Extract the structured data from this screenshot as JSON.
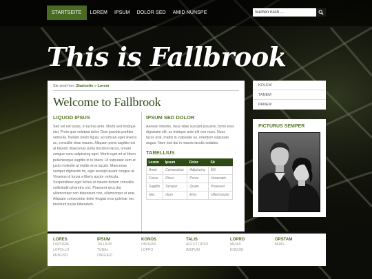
{
  "nav": {
    "items": [
      "STARTSEITE",
      "LOREM",
      "IPSUM",
      "DOLOR SED",
      "AMID NUNSPE"
    ],
    "active_index": 0
  },
  "search": {
    "placeholder": "Suchen nach ..."
  },
  "site": {
    "title": "This is Fallbrook"
  },
  "breadcrumb": {
    "prefix": "Sie sind hier:",
    "home": "Startseite",
    "separator": "»",
    "current": "Lorem"
  },
  "main": {
    "title": "Welcome to Fallbrook",
    "left": {
      "heading": "LIQUOD IPSUS",
      "text": "Sed vel est turpis, in lacinia ante. Morbi sed tristique nisi. Proin quis volutpat dolor. Duis gravida porttitor vehicula. Nullam lorem ligula, accumsan eget viverra ac, convallis vitae mauris. Aliquam porta sagittis nisi at blandit. Maecenas porta tincidunt lacus, ornare congue nunc adipiscing eget. Morbi eget mi ut libero pellentesque sagittis in in libero. Ut vulputate sem at justo molestie at mattis eros iaculis. Maecenas semper dignissim mi, eget suscipit quam congue at. Vivamus id turpis a libero auctor vehicula. Suspendisse eget lectus ut mauris dictum convallis sollicitudin pharetra orci. Praesent arcu dui, ullamcorper non bibendum non, ullamcorper et erat. Aliquam consectetur dolor feugiat eros pulvinar nec tincidunt turpis bibendum."
    },
    "right": {
      "heading": "IPSUM SED DOLOR",
      "text": "Aenean lobortis, risus vitae suscipit posuere, tortor eros dignissim elit, ac tristique ante elit non nunc. Nunc lacus erat, mattis in vulputate eu, interdum vulputate augue. Nam sed dui in mauris iaculis sodales.",
      "table_heading": "TABELLIUS",
      "table": {
        "headers": [
          "Lorem",
          "Ipsum",
          "Dolor",
          "Sit"
        ],
        "rows": [
          [
            "Amet",
            "Consectetur",
            "Adipiscing",
            "Elit"
          ],
          [
            "Fusce",
            "Risus",
            "Purus",
            "Venenatis"
          ],
          [
            "Sagittis",
            "Semper",
            "Quam",
            "Praesent"
          ],
          [
            "Nec",
            "diam",
            "Eros",
            "Ullamcorper"
          ]
        ]
      }
    }
  },
  "sidebar": {
    "menu": [
      "KOLEM",
      "TANEM",
      "PANEM"
    ],
    "box_title": "PICTURUS SEMPER"
  },
  "footer": {
    "columns": [
      {
        "heading": "LORES",
        "links": [
          "OSPORAL",
          "LOPOLLO",
          "MUKUSO"
        ]
      },
      {
        "heading": "IPSUM",
        "links": [
          "TALLIUM",
          "TUNAL",
          "ONGUED"
        ]
      },
      {
        "heading": "KONOS",
        "links": [
          "ONORAS",
          "LOPPO"
        ]
      },
      {
        "heading": "TALIS",
        "links": [
          "AFFLIT OPSO",
          "IMSPUM"
        ]
      },
      {
        "heading": "LOPRO",
        "links": [
          "MENIS",
          "ENQUID"
        ]
      },
      {
        "heading": "OPSTAM",
        "links": [
          "MIRIS"
        ]
      }
    ]
  },
  "colors": {
    "accent": "#4a6a23",
    "title_green": "#2e4a14",
    "heading_green": "#5a7a2a"
  },
  "icons": {
    "search": "magnifier-icon"
  }
}
